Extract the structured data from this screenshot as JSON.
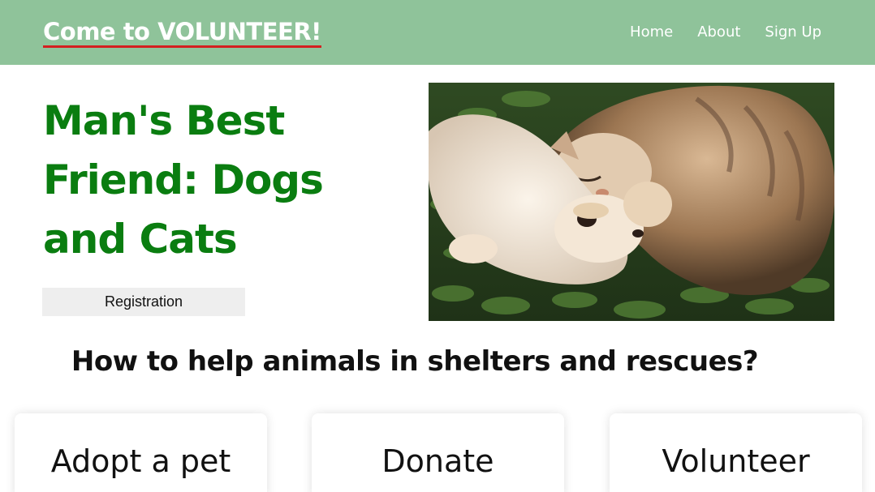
{
  "header": {
    "brand": "Come to VOLUNTEER!",
    "nav": [
      "Home",
      "About",
      "Sign Up"
    ],
    "background_color": "#8fc39a",
    "underline_color": "#d42020"
  },
  "hero": {
    "title": "Man's Best Friend: Dogs and Cats",
    "title_color": "#0a7d10",
    "button_label": "Registration",
    "image_alt": "photo-of-cat-and-dog-lying-on-grass"
  },
  "section": {
    "heading": "How to help animals in shelters and rescues?"
  },
  "cards": [
    {
      "label": "Adopt a pet"
    },
    {
      "label": "Donate"
    },
    {
      "label": "Volunteer"
    }
  ]
}
